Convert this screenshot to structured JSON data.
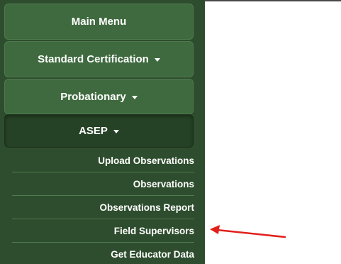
{
  "sidebar": {
    "menu": [
      {
        "label": "Main Menu",
        "dropdown": false,
        "active": false
      },
      {
        "label": "Standard Certification",
        "dropdown": true,
        "active": false
      },
      {
        "label": "Probationary",
        "dropdown": true,
        "active": false
      },
      {
        "label": "ASEP",
        "dropdown": true,
        "active": true
      }
    ],
    "submenu": [
      {
        "label": "Upload Observations"
      },
      {
        "label": "Observations"
      },
      {
        "label": "Observations Report"
      },
      {
        "label": "Field Supervisors"
      },
      {
        "label": "Get Educator Data"
      }
    ]
  },
  "annotation": {
    "icon": "red-arrow-icon",
    "color": "#e0201a"
  },
  "colors": {
    "sidebar_bg": "#2e4d2e",
    "button_bg": "#3f6a3f",
    "active_button_bg": "#264226"
  }
}
